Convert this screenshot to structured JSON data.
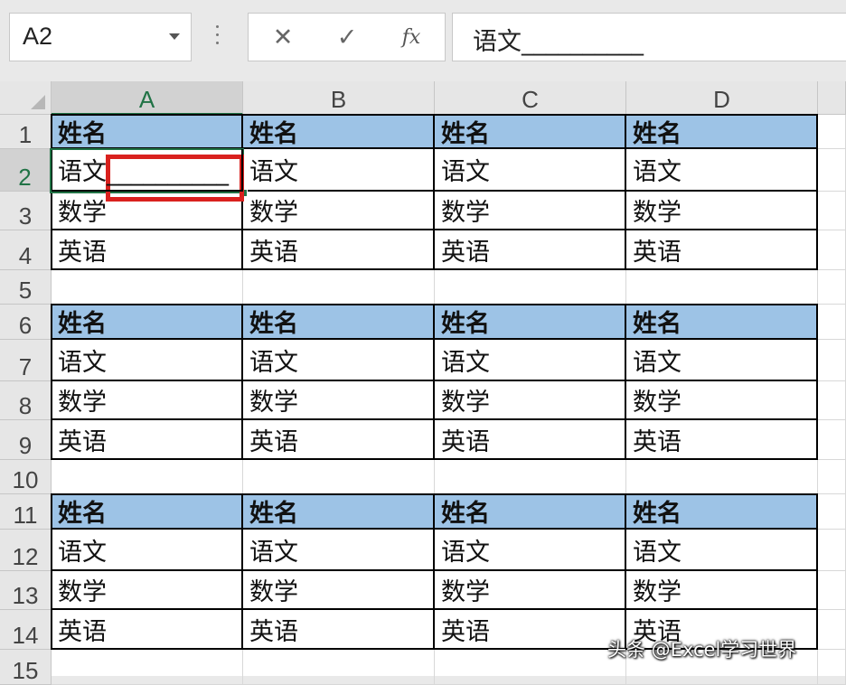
{
  "formula_bar": {
    "name_box": "A2",
    "cancel_symbol": "✕",
    "enter_symbol": "✓",
    "function_symbol": "fx",
    "content": "语文__________"
  },
  "columns": [
    "A",
    "B",
    "C",
    "D"
  ],
  "rows": [
    "1",
    "2",
    "3",
    "4",
    "5",
    "6",
    "7",
    "8",
    "9",
    "10",
    "11",
    "12",
    "13",
    "14",
    "15"
  ],
  "cells": {
    "r1": [
      "姓名",
      "姓名",
      "姓名",
      "姓名"
    ],
    "r2": [
      "语文__________",
      "语文",
      "语文",
      "语文"
    ],
    "r3": [
      "数学",
      "数学",
      "数学",
      "数学"
    ],
    "r4": [
      "英语",
      "英语",
      "英语",
      "英语"
    ],
    "r5": [
      "",
      "",
      "",
      ""
    ],
    "r6": [
      "姓名",
      "姓名",
      "姓名",
      "姓名"
    ],
    "r7": [
      "语文",
      "语文",
      "语文",
      "语文"
    ],
    "r8": [
      "数学",
      "数学",
      "数学",
      "数学"
    ],
    "r9": [
      "英语",
      "英语",
      "英语",
      "英语"
    ],
    "r10": [
      "",
      "",
      "",
      ""
    ],
    "r11": [
      "姓名",
      "姓名",
      "姓名",
      "姓名"
    ],
    "r12": [
      "语文",
      "语文",
      "语文",
      "语文"
    ],
    "r13": [
      "数学",
      "数学",
      "数学",
      "数学"
    ],
    "r14": [
      "英语",
      "英语",
      "英语",
      "英语"
    ],
    "r15": [
      "",
      "",
      "",
      ""
    ]
  },
  "selected_cell": "A2",
  "colors": {
    "header_fill": "#9dc3e6",
    "selection": "#217346",
    "highlight_box": "#d9211e"
  },
  "watermark": "头条 @Excel学习世界"
}
